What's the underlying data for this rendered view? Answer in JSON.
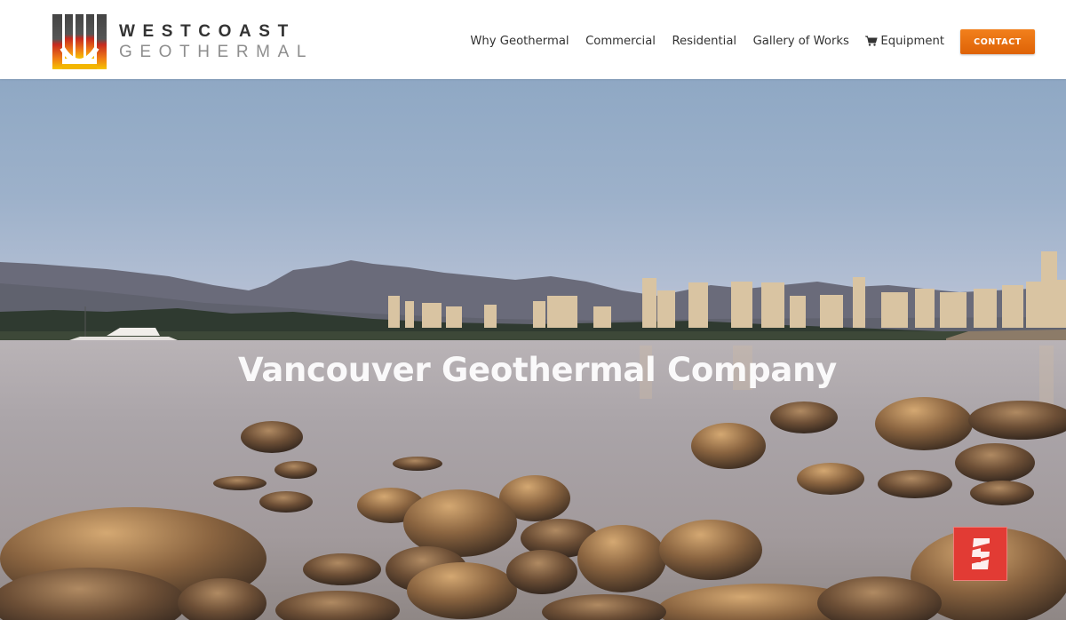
{
  "header": {
    "logo": {
      "line1": "WESTCOAST",
      "line2": "GEOTHERMAL",
      "icon": "wc-monogram-icon"
    },
    "nav": [
      {
        "label": "Why Geothermal"
      },
      {
        "label": "Commercial"
      },
      {
        "label": "Residential"
      },
      {
        "label": "Gallery of Works"
      },
      {
        "label": "Equipment",
        "icon": "shopping-cart-icon"
      }
    ],
    "contact_label": "CONTACT"
  },
  "hero": {
    "title": "Vancouver Geothermal Company"
  },
  "widget": {
    "icon": "security-badge-icon"
  },
  "colors": {
    "accent": "#f07818",
    "text": "#333333",
    "badge": "#e23b34"
  }
}
